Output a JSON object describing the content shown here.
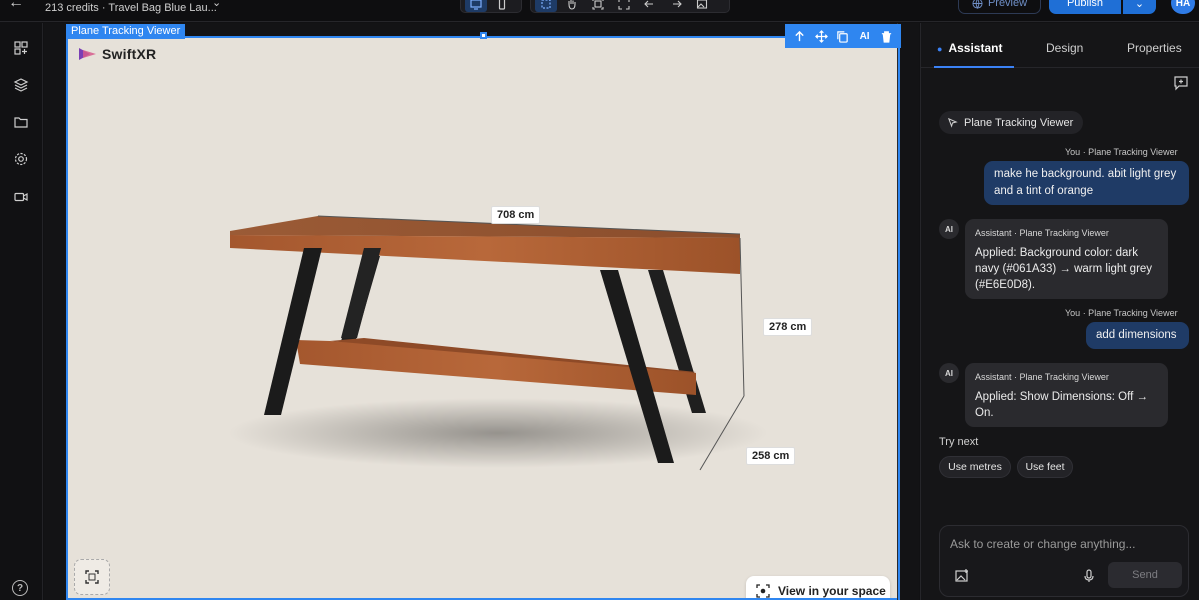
{
  "topbar": {
    "credits": "213 credits · Travel Bag Blue Lau...",
    "preview_label": "Preview",
    "publish_label": "Publish",
    "avatar_initials": "HA"
  },
  "viewer": {
    "label": "Plane Tracking Viewer",
    "ai_tool": "AI",
    "logo_text": "SwiftXR",
    "dimensions": {
      "width": "708 cm",
      "height": "278 cm",
      "depth": "258 cm"
    },
    "ar_button": "View in your space"
  },
  "panel": {
    "tabs": [
      {
        "label": "Assistant"
      },
      {
        "label": "Design"
      },
      {
        "label": "Properties"
      }
    ],
    "context_chip": "Plane Tracking Viewer",
    "messages": [
      {
        "meta": "You · Plane Tracking Viewer",
        "text": "make he background. abit light grey and a tint of orange"
      },
      {
        "badge": "AI",
        "meta": "Assistant · Plane Tracking Viewer",
        "text": "Applied: Background color: dark navy (#061A33) → warm light grey (#E6E0D8)."
      },
      {
        "meta": "You · Plane Tracking Viewer",
        "text": "add dimensions"
      },
      {
        "badge": "AI",
        "meta": "Assistant · Plane Tracking Viewer",
        "text": "Applied: Show Dimensions: Off → On."
      }
    ],
    "try_next": "Try next",
    "suggestions": [
      "Use metres",
      "Use feet"
    ],
    "composer": {
      "placeholder": "Ask to create or change anything...",
      "send_label": "Send"
    }
  },
  "colors": {
    "accent": "#2f86f0",
    "viewer_bg": "#e6e1d9",
    "user_bubble": "#1f3b66",
    "publish": "#1f6fd6"
  },
  "icons": [
    "back-arrow-icon",
    "chevron-down-icon",
    "desktop-icon",
    "mobile-icon",
    "select-icon",
    "hand-icon",
    "fit-icon",
    "expand-icon",
    "undo-icon",
    "redo-icon",
    "image-icon",
    "globe-icon",
    "grid-icon",
    "layers-icon",
    "folder-icon",
    "gear-icon",
    "video-icon",
    "help-icon",
    "arrow-up-icon",
    "move-icon",
    "copy-icon",
    "trash-icon",
    "ar-icon",
    "fullscreen-icon",
    "new-chat-icon",
    "cursor-icon",
    "image-upload-icon",
    "mic-icon"
  ]
}
